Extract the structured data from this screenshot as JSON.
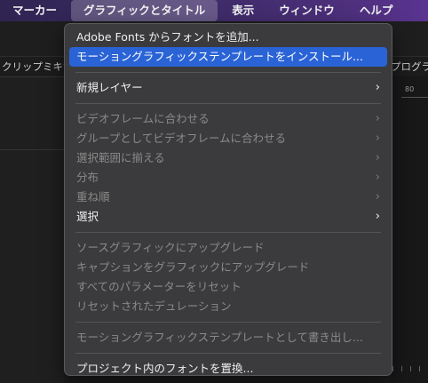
{
  "menubar": {
    "items": [
      "マーカー",
      "グラフィックとタイトル",
      "表示",
      "ウィンドウ",
      "ヘルプ"
    ]
  },
  "background": {
    "left_tab": "クリップミキサ",
    "right_tab": "プログラム",
    "ruler_label": "80"
  },
  "menu": {
    "groups": [
      [
        {
          "label": "Adobe Fonts からフォントを追加...",
          "enabled": true
        },
        {
          "label": "モーショングラフィックステンプレートをインストール...",
          "enabled": true,
          "highlighted": true
        }
      ],
      [
        {
          "label": "新規レイヤー",
          "enabled": true,
          "submenu": true
        }
      ],
      [
        {
          "label": "ビデオフレームに合わせる",
          "enabled": false,
          "submenu": true
        },
        {
          "label": "グループとしてビデオフレームに合わせる",
          "enabled": false,
          "submenu": true
        },
        {
          "label": "選択範囲に揃える",
          "enabled": false,
          "submenu": true
        },
        {
          "label": "分布",
          "enabled": false,
          "submenu": true
        },
        {
          "label": "重ね順",
          "enabled": false,
          "submenu": true
        },
        {
          "label": "選択",
          "enabled": true,
          "submenu": true
        }
      ],
      [
        {
          "label": "ソースグラフィックにアップグレード",
          "enabled": false
        },
        {
          "label": "キャプションをグラフィックにアップグレード",
          "enabled": false
        },
        {
          "label": "すべてのパラメーターをリセット",
          "enabled": false
        },
        {
          "label": "リセットされたデュレーション",
          "enabled": false
        }
      ],
      [
        {
          "label": "モーショングラフィックステンプレートとして書き出し...",
          "enabled": false
        }
      ],
      [
        {
          "label": "プロジェクト内のフォントを置換...",
          "enabled": true
        }
      ]
    ],
    "submenu_icon": "chevron-right-icon"
  }
}
